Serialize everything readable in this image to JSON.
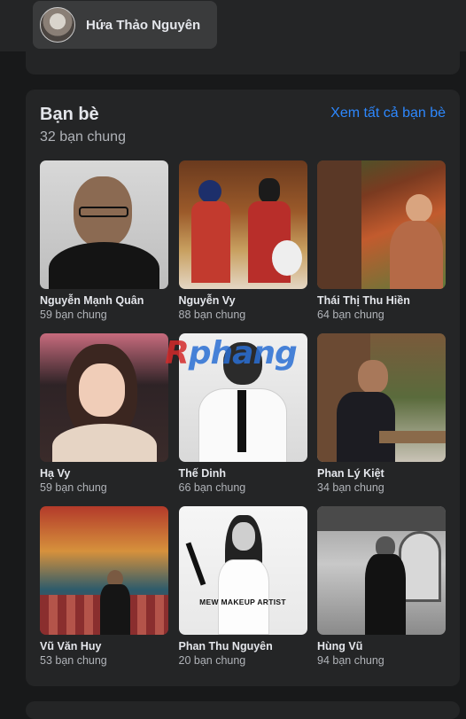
{
  "profile": {
    "name": "Hứa Thảo Nguyên"
  },
  "friends_section": {
    "title": "Bạn bè",
    "subtitle": "32 bạn chung",
    "see_all_label": "Xem tất cả bạn bè",
    "friends": [
      {
        "name": "Nguyễn Mạnh Quân",
        "mutual": "59 bạn chung"
      },
      {
        "name": "Nguyễn Vy",
        "mutual": "88 bạn chung"
      },
      {
        "name": "Thái Thị Thu Hiền",
        "mutual": "64 bạn chung"
      },
      {
        "name": "Hạ Vy",
        "mutual": "59 bạn chung"
      },
      {
        "name": "Thế Dinh",
        "mutual": "66 bạn chung"
      },
      {
        "name": "Phan Lý Kiệt",
        "mutual": "34 bạn chung"
      },
      {
        "name": "Vũ Văn Huy",
        "mutual": "53 bạn chung"
      },
      {
        "name": "Phan Thu Nguyên",
        "mutual": "20 bạn chung"
      },
      {
        "name": "Hùng Vũ",
        "mutual": "94 bạn chung"
      }
    ],
    "photo_caption": "MEW MAKEUP ARTIST"
  },
  "watermark": {
    "first": "R",
    "rest": "phang"
  }
}
